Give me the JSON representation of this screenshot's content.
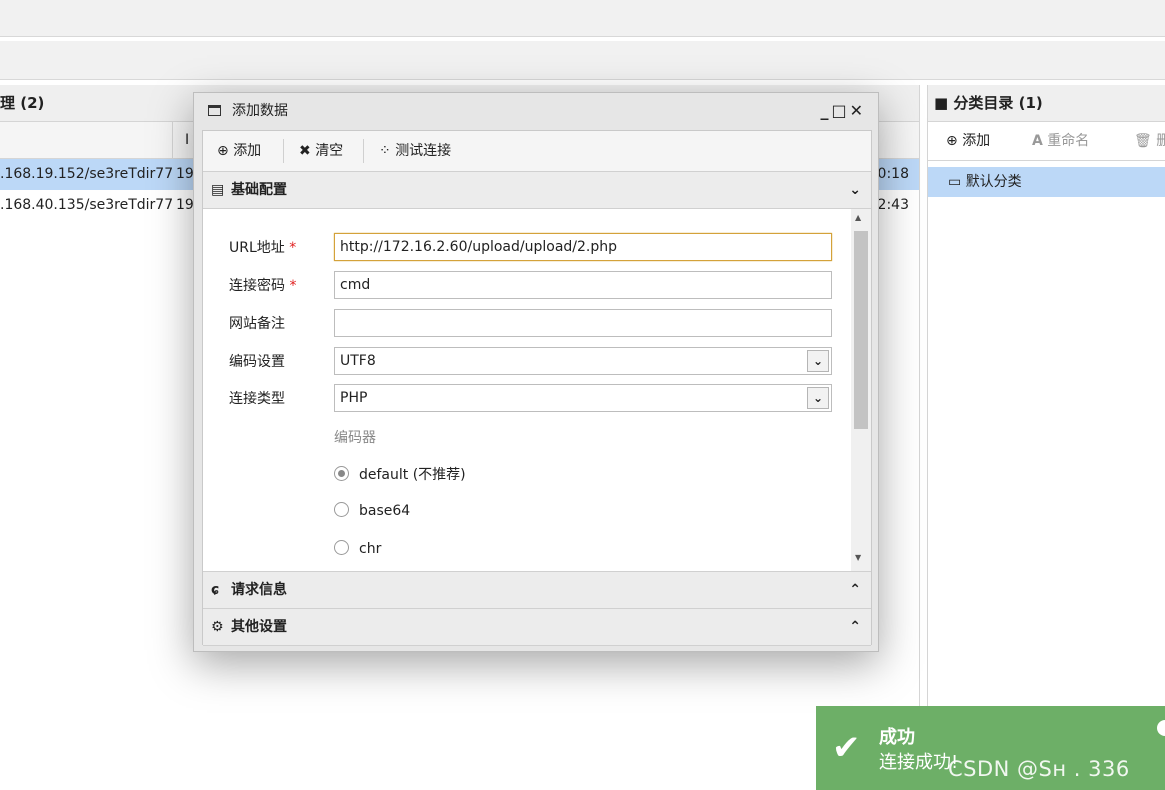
{
  "left_panel": {
    "title": "理 (2)",
    "col2_header": "I",
    "rows": [
      {
        "url": ".168.19.152/se3reTdir77",
        "ip": "19",
        "time": "0:18"
      },
      {
        "url": ".168.40.135/se3reTdir77",
        "ip": "19",
        "time": "2:43"
      }
    ]
  },
  "right_panel": {
    "title": "分类目录 (1)",
    "toolbar": {
      "add": "添加",
      "rename": "重命名",
      "delete": "删"
    },
    "category": "默认分类"
  },
  "dialog": {
    "title": "添加数据",
    "controls": "_ □ ×",
    "toolbar": {
      "add": "添加",
      "clear": "清空",
      "test": "测试连接"
    },
    "sections": {
      "basic": "基础配置",
      "request": "请求信息",
      "other": "其他设置"
    },
    "form": {
      "url_label": "URL地址",
      "url_value": "http://172.16.2.60/upload/upload/2.php",
      "password_label": "连接密码",
      "password_value": "cmd",
      "note_label": "网站备注",
      "note_value": "",
      "encoding_label": "编码设置",
      "encoding_value": "UTF8",
      "type_label": "连接类型",
      "type_value": "PHP",
      "encoder_label": "编码器",
      "encoders": [
        "default (不推荐)",
        "base64",
        "chr"
      ],
      "selected_encoder": "default (不推荐)"
    }
  },
  "toast": {
    "title": "成功",
    "message": "连接成功!",
    "color": "#6daf67"
  },
  "watermark": "CSDN @Sʜ    . 336"
}
